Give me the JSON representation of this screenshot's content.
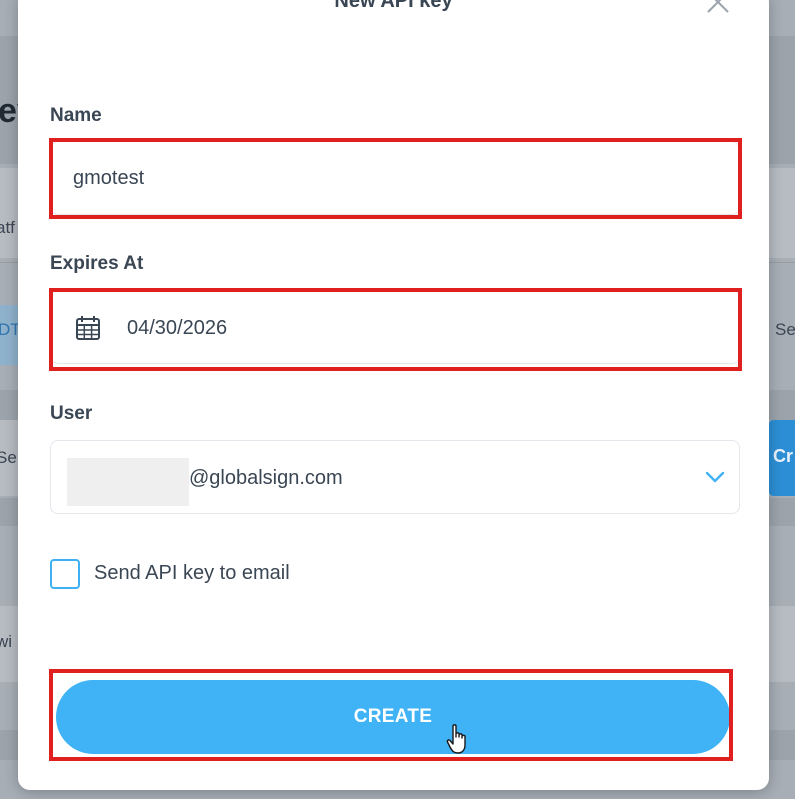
{
  "background": {
    "heading_fragment": "ey",
    "row_fragments": [
      "atf",
      "DT",
      "Se",
      "Se",
      "wi"
    ],
    "create_fragment": "Cr"
  },
  "modal": {
    "title": "New API key",
    "close_icon": "close-icon",
    "name": {
      "label": "Name",
      "value": "gmotest"
    },
    "expires": {
      "label": "Expires At",
      "value": "04/30/2026",
      "icon": "calendar-icon"
    },
    "user": {
      "label": "User",
      "value": "@globalsign.com",
      "icon": "chevron-down-icon"
    },
    "send_email": {
      "label": "Send API key to email",
      "checked": false
    },
    "create_button": "CREATE"
  },
  "colors": {
    "accent": "#3fb3f6",
    "highlight": "#e0201f",
    "text": "#3a4654"
  }
}
